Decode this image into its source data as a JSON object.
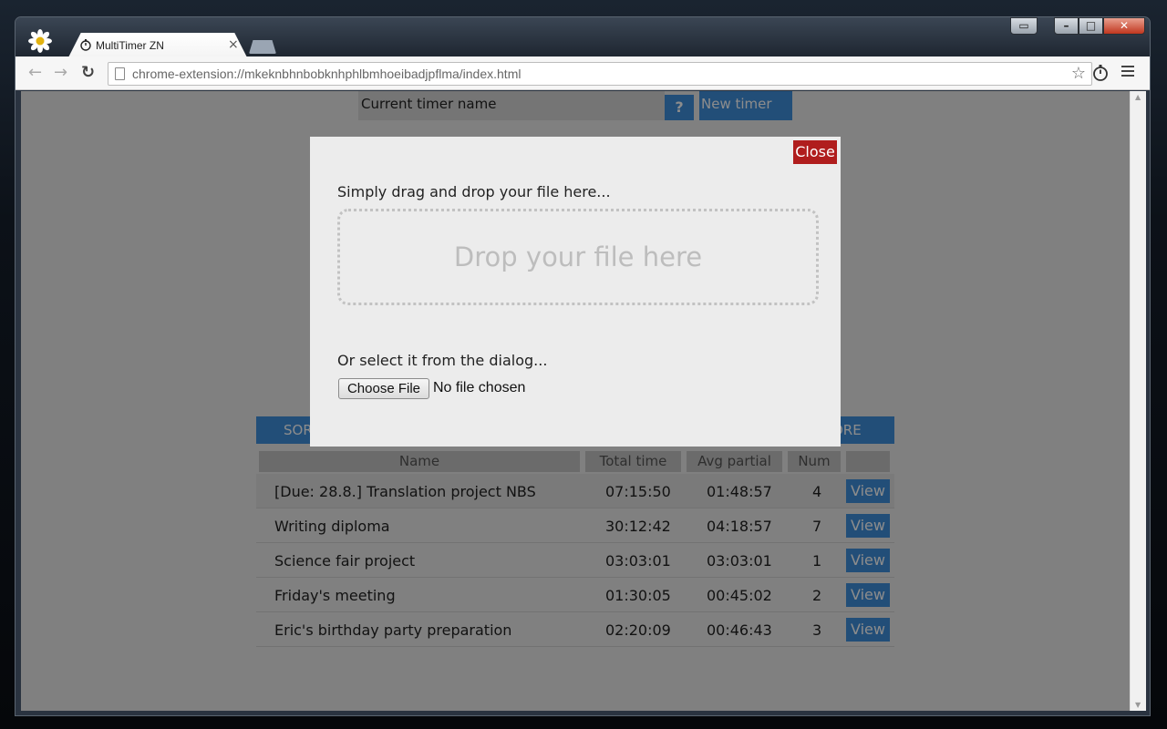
{
  "browser": {
    "tab_title": "MultiTimer ZN",
    "tab_close": "×",
    "url": "chrome-extension://mkeknbhnbobknhphlbmhoeibadjpflma/index.html"
  },
  "app": {
    "current_timer_label": "Current timer name",
    "help_label": "?",
    "new_timer_label": "New timer",
    "bar_left_label": "SOR",
    "bar_right_label": "ORE",
    "columns": {
      "name": "Name",
      "total": "Total time",
      "avg": "Avg partial",
      "num": "Num",
      "action": ""
    },
    "rows": [
      {
        "name": "[Due: 28.8.] Translation project NBS",
        "total": "07:15:50",
        "avg": "01:48:57",
        "num": "4",
        "action": "View"
      },
      {
        "name": "Writing diploma",
        "total": "30:12:42",
        "avg": "04:18:57",
        "num": "7",
        "action": "View"
      },
      {
        "name": "Science fair project",
        "total": "03:03:01",
        "avg": "03:03:01",
        "num": "1",
        "action": "View"
      },
      {
        "name": "Friday's meeting",
        "total": "01:30:05",
        "avg": "00:45:02",
        "num": "2",
        "action": "View"
      },
      {
        "name": "Eric's birthday party preparation",
        "total": "02:20:09",
        "avg": "00:46:43",
        "num": "3",
        "action": "View"
      }
    ]
  },
  "modal": {
    "close_label": "Close",
    "drag_hint": "Simply drag and drop your file here...",
    "drop_label": "Drop your file here",
    "select_hint": "Or select it from the dialog...",
    "choose_label": "Choose File",
    "no_file_label": "No file chosen"
  },
  "colors": {
    "accent": "#3f8edb",
    "close": "#b01d1d"
  }
}
